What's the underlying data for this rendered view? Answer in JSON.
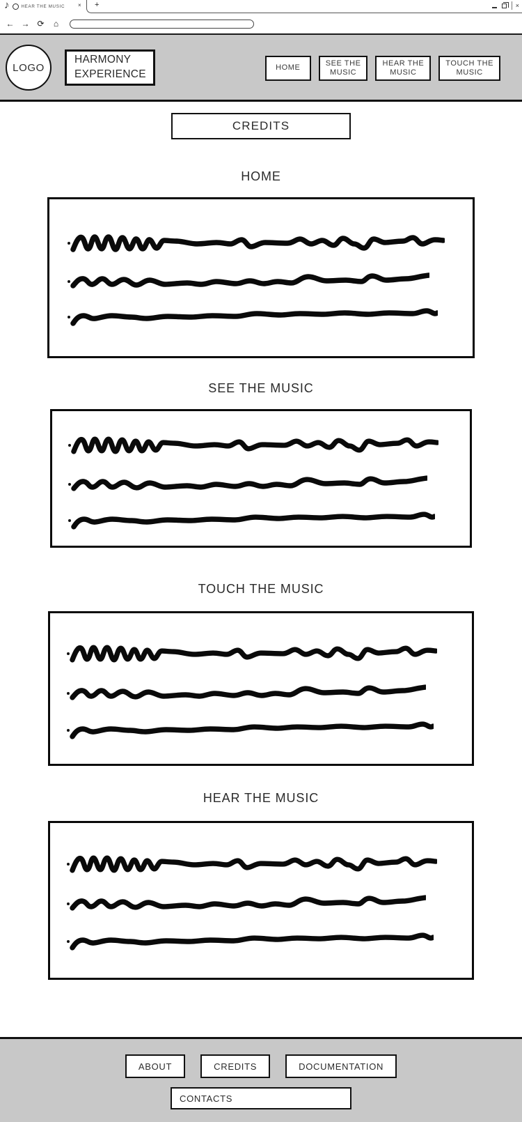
{
  "browser": {
    "tab": {
      "title": "HEAR THE MUSIC",
      "favicon_icon": "circle-icon",
      "note_icon": "music-note-icon",
      "close_icon": "×"
    },
    "new_tab_icon": "+",
    "nav": {
      "back_icon": "←",
      "forward_icon": "→",
      "reload_icon": "⟳",
      "home_icon": "⌂"
    },
    "url_value": "",
    "url_placeholder": "",
    "window_controls": {
      "minimize_icon": "minimize-icon",
      "maximize_icon": "maximize-icon",
      "close_icon": "×"
    }
  },
  "header": {
    "logo_label": "LOGO",
    "brand_line_1": "HARMONY",
    "brand_line_2": "EXPERIENCE",
    "nav_items": [
      {
        "label": "HOME"
      },
      {
        "label": "SEE THE\nMUSIC"
      },
      {
        "label": "HEAR THE\nMUSIC"
      },
      {
        "label": "TOUCH THE\nMUSIC"
      }
    ]
  },
  "main": {
    "page_title": "CREDITS",
    "sections": [
      {
        "title": "HOME"
      },
      {
        "title": "SEE THE MUSIC"
      },
      {
        "title": "TOUCH THE MUSIC"
      },
      {
        "title": "HEAR THE MUSIC"
      }
    ]
  },
  "footer": {
    "links": [
      {
        "label": "ABOUT"
      },
      {
        "label": "CREDITS"
      },
      {
        "label": "DOCUMENTATION"
      }
    ],
    "contacts_label": "CONTACTS"
  },
  "colors": {
    "chrome_gray": "#c8c8c8",
    "ink": "#111111",
    "page_background": "#ffffff"
  }
}
